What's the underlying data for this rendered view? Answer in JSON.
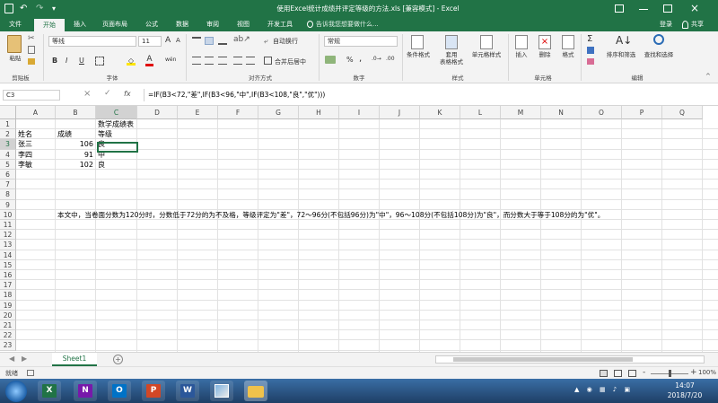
{
  "titlebar": {
    "title": "使用Excel统计成绩并评定等级的方法.xls [兼容模式] - Excel",
    "qa_icons": [
      "save-icon",
      "undo-icon",
      "redo-icon",
      "customize-icon"
    ],
    "buttons": [
      "restore-icon",
      "minimize-icon",
      "maximize-icon",
      "close-icon"
    ]
  },
  "tabs": [
    {
      "label": "文件"
    },
    {
      "label": "开始"
    },
    {
      "label": "插入"
    },
    {
      "label": "页面布局"
    },
    {
      "label": "公式"
    },
    {
      "label": "数据"
    },
    {
      "label": "审阅"
    },
    {
      "label": "视图"
    },
    {
      "label": "开发工具"
    }
  ],
  "tellme": "告诉我您想要做什么...",
  "login": "登录",
  "share": "共享",
  "ribbon": {
    "clipboard": {
      "paste": "粘贴",
      "label": "剪贴板"
    },
    "font": {
      "name": "等线",
      "size": "11",
      "label": "字体",
      "bold": "B",
      "italic": "I",
      "underline": "U",
      "grow": "A",
      "shrink": "A",
      "fontcolor": "A",
      "phonetic": "wén"
    },
    "alignment": {
      "wrap": "自动换行",
      "merge": "合并后居中",
      "label": "对齐方式"
    },
    "number": {
      "format": "常规",
      "percent": "%",
      "comma": ",",
      "label": "数字"
    },
    "styles": {
      "cond": "条件格式",
      "table": "套用\n表格格式",
      "cell": "单元格样式",
      "label": "样式"
    },
    "cells": {
      "insert": "插入",
      "delete": "删除",
      "format": "格式",
      "label": "单元格"
    },
    "editing": {
      "sum": "Σ",
      "sort": "排序和筛选",
      "find": "查找和选择",
      "label": "编辑"
    }
  },
  "formula_bar": {
    "namebox": "C3",
    "fx": "fx",
    "cancel": "×",
    "enter": "✓",
    "formula": "=IF(B3<72,\"差\",IF(B3<96,\"中\",IF(B3<108,\"良\",\"优\")))"
  },
  "columns": [
    "A",
    "B",
    "C",
    "D",
    "E",
    "F",
    "G",
    "H",
    "I",
    "J",
    "K",
    "L",
    "M",
    "N",
    "O",
    "P",
    "Q"
  ],
  "rows": [
    "1",
    "2",
    "3",
    "4",
    "5",
    "6",
    "7",
    "8",
    "9",
    "10",
    "11",
    "12",
    "13",
    "14",
    "15",
    "16",
    "17",
    "18",
    "19",
    "20",
    "21",
    "22",
    "23"
  ],
  "cells": {
    "C1": "数学成绩表",
    "A2": "姓名",
    "B2": "成绩",
    "C2": "等级",
    "A3": "张三",
    "B3": "106",
    "C3": "良",
    "A4": "李四",
    "B4": "91",
    "C4": "中",
    "A5": "李敏",
    "B5": "102",
    "C5": "良",
    "B10": "本文中，当卷面分数为120分时，分数低于72分的为不及格，等级评定为\"差\"，72～96分(不包括96分)为\"中\"，96～108分(不包括108分)为\"良\"，而分数大于等于108分的为\"优\"。"
  },
  "sheet_tab": "Sheet1",
  "add_sheet": "+",
  "status": {
    "ready": "就绪",
    "zoom": "100%",
    "zoom_minus": "-",
    "zoom_plus": "+"
  },
  "taskbar": {
    "time": "14:07",
    "date": "2018/7/20",
    "apps": [
      "excel-icon",
      "onenote-icon",
      "outlook-icon",
      "powerpoint-icon",
      "word-icon",
      "paint-icon",
      "folder-icon"
    ],
    "app_letters": [
      "X",
      "N",
      "O",
      "P",
      "W"
    ],
    "app_colors": [
      "#217346",
      "#7719aa",
      "#0072c6",
      "#d24726",
      "#2b579a"
    ]
  }
}
